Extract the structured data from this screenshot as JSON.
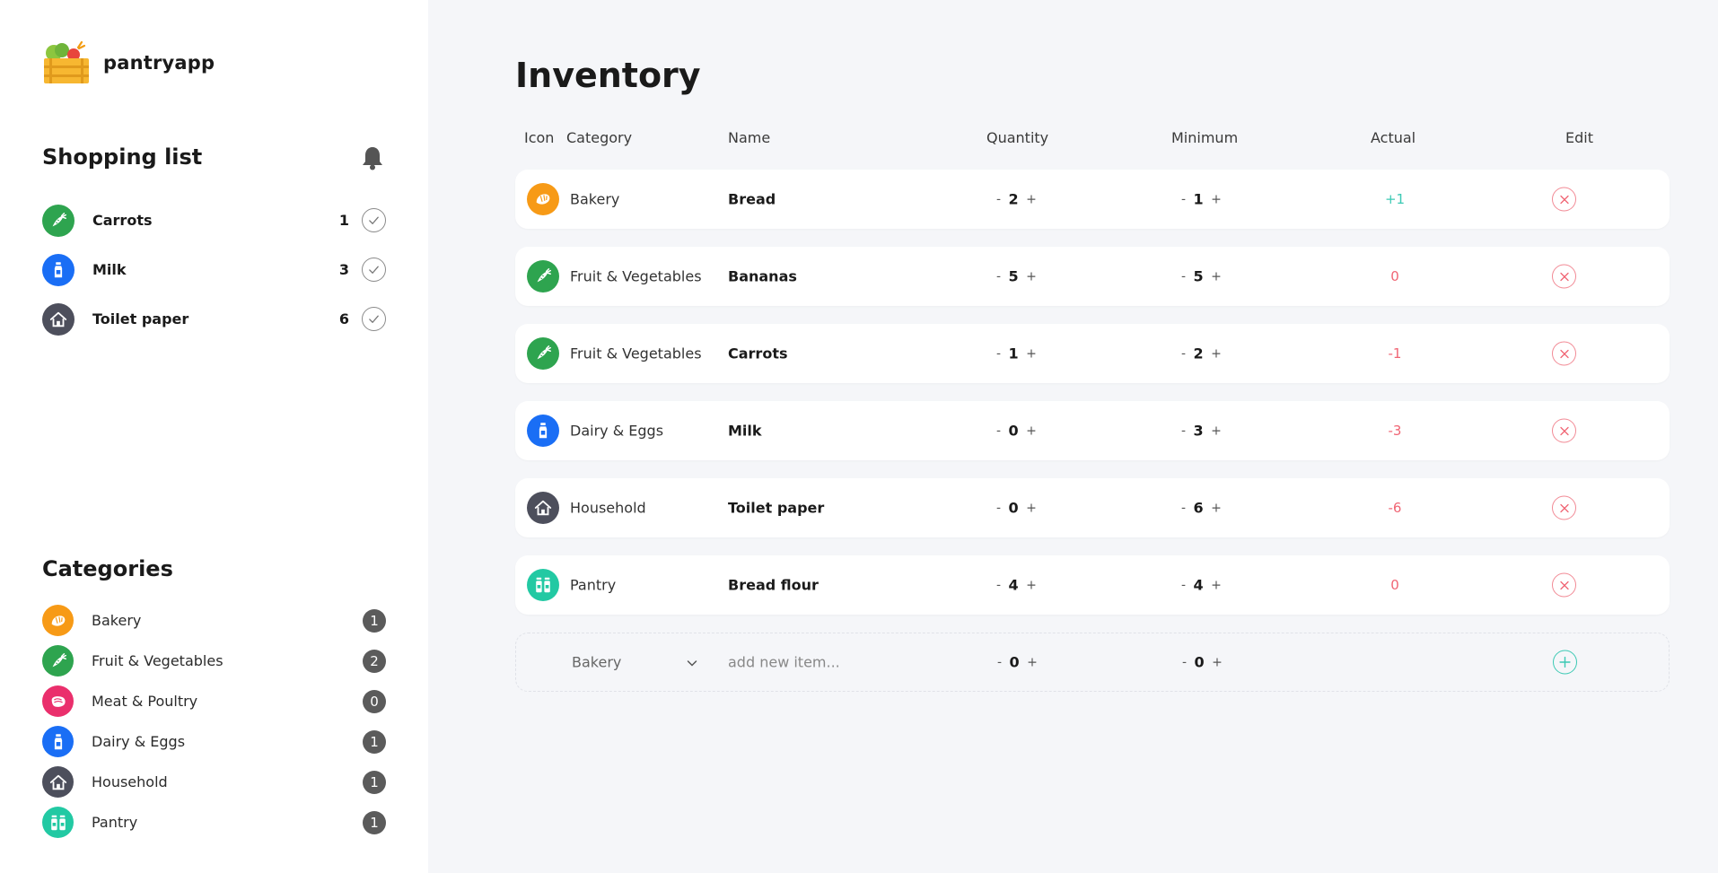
{
  "app": {
    "name": "pantryapp"
  },
  "colors": {
    "bakery": "#f79a16",
    "fruit_veg": "#2ea44f",
    "meat": "#ea2f6c",
    "dairy": "#1a6ef5",
    "household": "#4d4f5c",
    "pantry": "#22c9a3",
    "positive": "#3cc9b4",
    "negative": "#f06574"
  },
  "shopping": {
    "title": "Shopping list",
    "items": [
      {
        "name": "Carrots",
        "qty": "1",
        "icon": "carrot-icon",
        "category": "fruit_veg"
      },
      {
        "name": "Milk",
        "qty": "3",
        "icon": "milk-icon",
        "category": "dairy"
      },
      {
        "name": "Toilet paper",
        "qty": "6",
        "icon": "house-icon",
        "category": "household"
      }
    ]
  },
  "categories": {
    "title": "Categories",
    "items": [
      {
        "name": "Bakery",
        "count": "1",
        "icon": "croissant-icon"
      },
      {
        "name": "Fruit & Vegetables",
        "count": "2",
        "icon": "carrot-icon"
      },
      {
        "name": "Meat & Poultry",
        "count": "0",
        "icon": "meat-icon"
      },
      {
        "name": "Dairy & Eggs",
        "count": "1",
        "icon": "milk-icon"
      },
      {
        "name": "Household",
        "count": "1",
        "icon": "house-icon"
      },
      {
        "name": "Pantry",
        "count": "1",
        "icon": "jars-icon"
      }
    ]
  },
  "inventory": {
    "title": "Inventory",
    "columns": {
      "icon": "Icon",
      "category": "Category",
      "name": "Name",
      "quantity": "Quantity",
      "minimum": "Minimum",
      "actual": "Actual",
      "edit": "Edit"
    },
    "rows": [
      {
        "category": "Bakery",
        "name": "Bread",
        "quantity": "2",
        "minimum": "1",
        "actual": "+1"
      },
      {
        "category": "Fruit & Vegetables",
        "name": "Bananas",
        "quantity": "5",
        "minimum": "5",
        "actual": "0"
      },
      {
        "category": "Fruit & Vegetables",
        "name": "Carrots",
        "quantity": "1",
        "minimum": "2",
        "actual": "-1"
      },
      {
        "category": "Dairy & Eggs",
        "name": "Milk",
        "quantity": "0",
        "minimum": "3",
        "actual": "-3"
      },
      {
        "category": "Household",
        "name": "Toilet paper",
        "quantity": "0",
        "minimum": "6",
        "actual": "-6"
      },
      {
        "category": "Pantry",
        "name": "Bread flour",
        "quantity": "4",
        "minimum": "4",
        "actual": "0"
      }
    ],
    "new_item": {
      "category": "Bakery",
      "placeholder": "add new item...",
      "quantity": "0",
      "minimum": "0"
    },
    "stepper": {
      "minus": "-",
      "plus": "+"
    }
  }
}
